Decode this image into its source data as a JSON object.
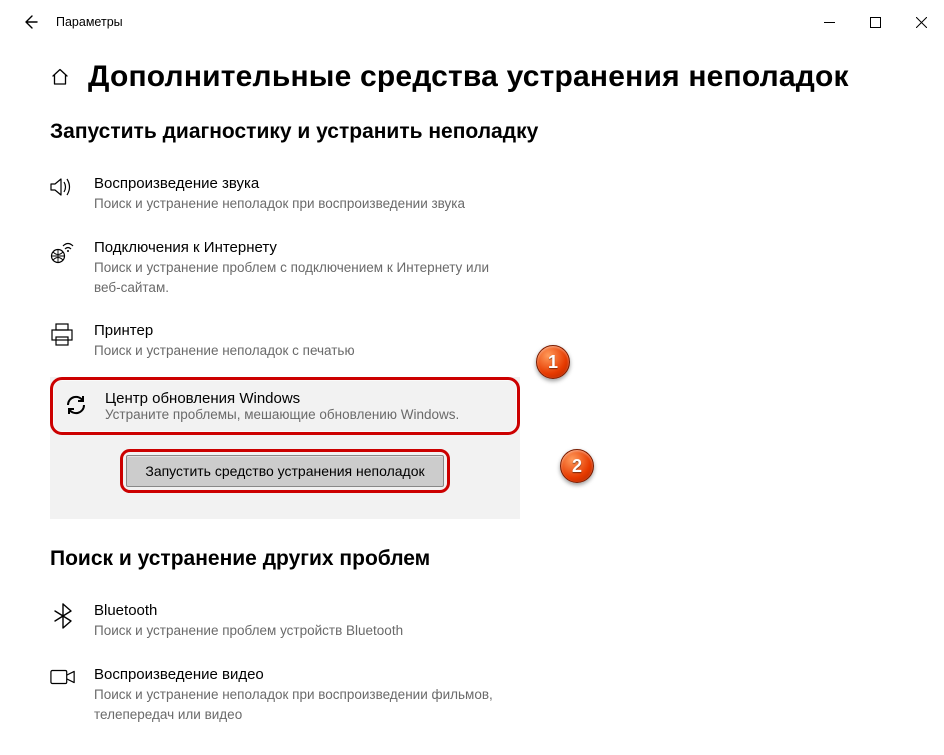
{
  "window": {
    "title": "Параметры"
  },
  "page": {
    "heading": "Дополнительные средства устранения неполадок"
  },
  "section1": {
    "title": "Запустить диагностику и устранить неполадку",
    "items": {
      "audio": {
        "label": "Воспроизведение звука",
        "desc": "Поиск и устранение неполадок при воспроизведении звука"
      },
      "net": {
        "label": "Подключения к Интернету",
        "desc": "Поиск и устранение проблем с подключением к Интернету или веб-сайтам."
      },
      "printer": {
        "label": "Принтер",
        "desc": "Поиск и устранение неполадок с печатью"
      },
      "wu": {
        "label": "Центр обновления Windows",
        "desc": "Устраните проблемы, мешающие обновлению Windows."
      }
    },
    "run_button": "Запустить средство устранения неполадок"
  },
  "section2": {
    "title": "Поиск и устранение других проблем",
    "items": {
      "bt": {
        "label": "Bluetooth",
        "desc": "Поиск и устранение проблем устройств Bluetooth"
      },
      "video": {
        "label": "Воспроизведение видео",
        "desc": "Поиск и устранение неполадок при воспроизведении фильмов, телепередач или видео"
      }
    }
  },
  "callouts": {
    "one": "1",
    "two": "2"
  }
}
